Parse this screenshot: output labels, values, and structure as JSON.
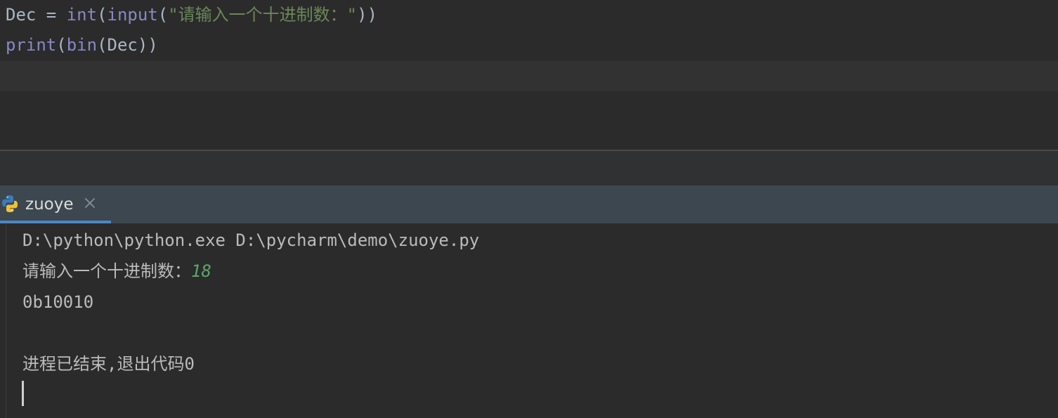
{
  "editor": {
    "line1": {
      "var": "Dec",
      "eq": " = ",
      "fn_int": "int",
      "open1": "(",
      "fn_input": "input",
      "open2": "(",
      "string": "\"请输入一个十进制数：\"",
      "close": "))"
    },
    "line2": {
      "fn_print": "print",
      "open1": "(",
      "fn_bin": "bin",
      "open2": "(",
      "var": "Dec",
      "close": "))"
    }
  },
  "run_panel": {
    "tab_label": "zuoye",
    "tab_icon": "python-icon",
    "close_icon": "close-icon"
  },
  "console": {
    "command": "D:\\python\\python.exe D:\\pycharm\\demo\\zuoye.py",
    "prompt": "请输入一个十进制数：",
    "user_input": "18",
    "output": "0b10010",
    "exit_message": "进程已结束,退出代码0"
  },
  "colors": {
    "background": "#2b2b2b",
    "builtin": "#8888c6",
    "string": "#6a8759",
    "user_input": "#59a869",
    "tab_bar": "#3c4750",
    "tab_underline": "#4a88c7"
  }
}
